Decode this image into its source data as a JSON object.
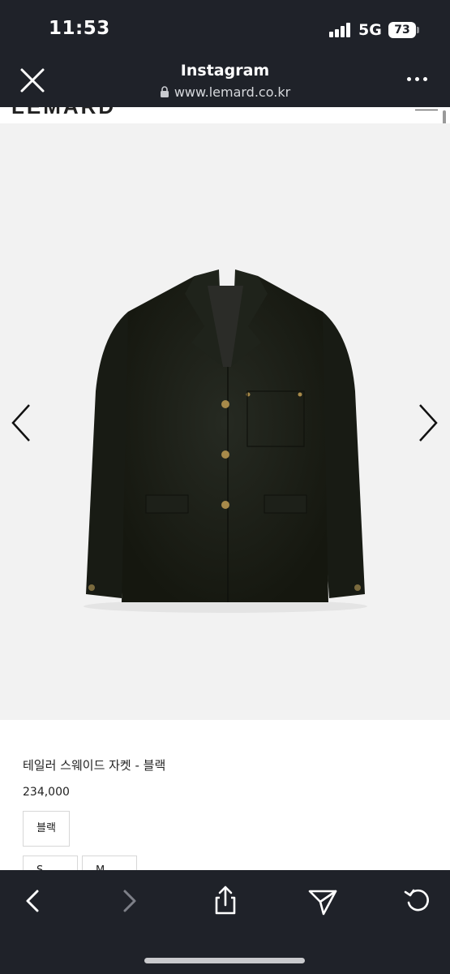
{
  "status_bar": {
    "time": "11:53",
    "network": "5G",
    "battery": "73",
    "icons": [
      "signal-icon",
      "battery-icon"
    ]
  },
  "browser": {
    "title": "Instagram",
    "url": "www.lemard.co.kr",
    "icons": [
      "close-icon",
      "lock-icon",
      "more-icon"
    ]
  },
  "site": {
    "logo": "LEMARD",
    "menu_icon": "hamburger-menu-icon"
  },
  "gallery": {
    "image": "black-suede-tailored-jacket",
    "prev_icon": "chevron-left-icon",
    "next_icon": "chevron-right-icon"
  },
  "product": {
    "name": "테일러 스웨이드 자켓 - 블랙",
    "price": "234,000",
    "color_option": "블랙",
    "size_options": [
      "S",
      "M"
    ]
  },
  "toolbar": {
    "icons": [
      "back-icon",
      "forward-icon",
      "share-icon",
      "send-icon",
      "reload-icon"
    ]
  },
  "colors": {
    "chrome_bg": "#1f2229",
    "gallery_bg": "#f2f2f2",
    "jacket": "#1b1e18",
    "button_gold": "#a88a4a"
  }
}
